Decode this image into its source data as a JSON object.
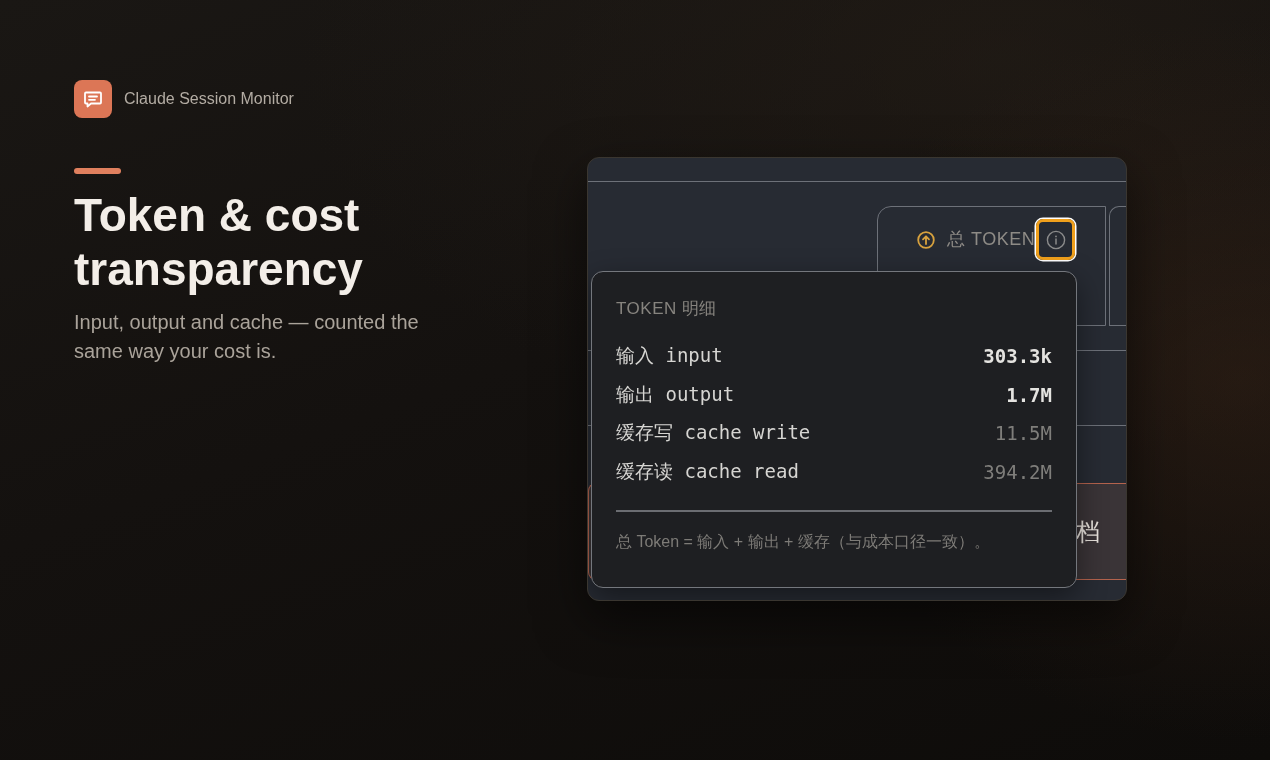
{
  "brand": {
    "name": "Claude Session Monitor"
  },
  "hero": {
    "title": "Token & cost transparency",
    "subtitle": "Input, output and cache — counted the same way your cost is."
  },
  "screenshot": {
    "stat_card": {
      "label": "总 TOKEN",
      "info_button": {
        "focused": true
      }
    },
    "tooltip": {
      "title": "TOKEN 明细",
      "rows": [
        {
          "label": "输入 input",
          "value": "303.3k",
          "emphasized": true
        },
        {
          "label": "输出 output",
          "value": "1.7M",
          "emphasized": true
        },
        {
          "label": "缓存写 cache write",
          "value": "11.5M",
          "emphasized": false
        },
        {
          "label": "缓存读 cache read",
          "value": "394.2M",
          "emphasized": false
        }
      ],
      "footnote": "总 Token = 输入 + 输出 + 缓存（与成本口径一致）。"
    },
    "partial_card": {
      "text": "档"
    }
  }
}
